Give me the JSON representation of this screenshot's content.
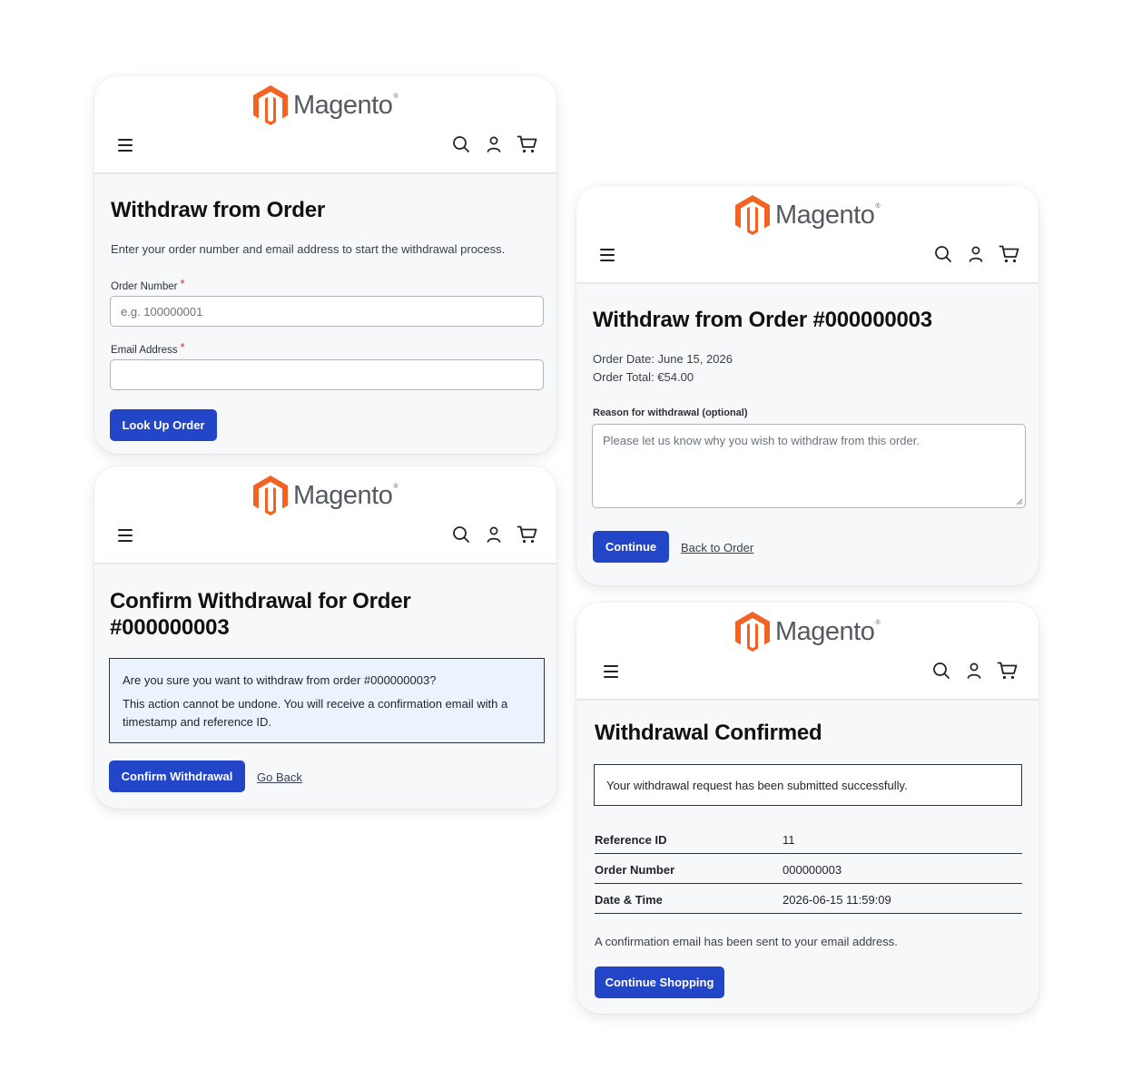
{
  "brand": {
    "name": "Magento",
    "mark": "®"
  },
  "colors": {
    "accent": "#2346c8",
    "logo": "#f26322",
    "required": "#e02b27"
  },
  "icons": [
    "menu-icon",
    "search-icon",
    "account-icon",
    "cart-icon"
  ],
  "lookup": {
    "title": "Withdraw from Order",
    "intro": "Enter your order number and email address to start the withdrawal process.",
    "order_label": "Order Number",
    "order_placeholder": "e.g. 100000001",
    "email_label": "Email Address",
    "required_mark": "*",
    "button": "Look Up Order"
  },
  "confirm": {
    "title_line1": "Confirm Withdrawal for Order",
    "title_line2": "#000000003",
    "question": "Are you sure you want to withdraw from order #000000003?",
    "warning": "This action cannot be undone. You will receive a confirmation email with a timestamp and reference ID.",
    "button": "Confirm Withdrawal",
    "back_link": "Go Back"
  },
  "reason": {
    "title": "Withdraw from Order #000000003",
    "order_date": "Order Date: June 15, 2026",
    "order_total": "Order Total: €54.00",
    "reason_label": "Reason for withdrawal (optional)",
    "reason_placeholder": "Please let us know why you wish to withdraw from this order.",
    "button": "Continue",
    "back_link": "Back to Order"
  },
  "success": {
    "title": "Withdrawal Confirmed",
    "message": "Your withdrawal request has been submitted successfully.",
    "rows": [
      {
        "key": "Reference ID",
        "value": "11"
      },
      {
        "key": "Order Number",
        "value": "000000003"
      },
      {
        "key": "Date & Time",
        "value": "2026-06-15 11:59:09"
      }
    ],
    "email_note": "A confirmation email has been sent to your email address.",
    "button": "Continue Shopping"
  }
}
